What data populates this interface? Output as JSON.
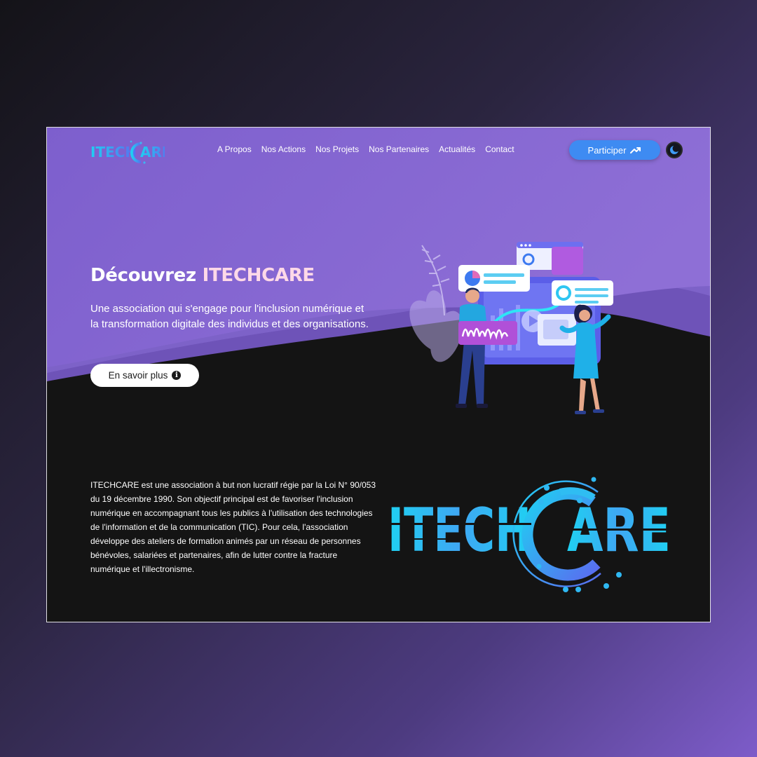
{
  "brand": {
    "logo_text_left": "ITECH",
    "logo_text_right": "ARE",
    "primary_color": "#3e8bf2",
    "accent_gradient": [
      "#1fd0f2",
      "#5a6cf0"
    ]
  },
  "nav": {
    "items": [
      {
        "label": "A Propos"
      },
      {
        "label": "Nos Actions"
      },
      {
        "label": "Nos Projets"
      },
      {
        "label": "Nos Partenaires"
      },
      {
        "label": "Actualités"
      },
      {
        "label": "Contact"
      }
    ]
  },
  "header": {
    "participate_label": "Participer",
    "participate_icon": "trending-up-icon",
    "theme_toggle_icon": "moon-icon"
  },
  "hero": {
    "title_prefix": "Découvrez ",
    "title_brand": "ITECHCARE",
    "subtitle": "Une association qui s'engage pour l'inclusion numérique et la transformation digitale des individus et des organisations.",
    "cta_label": "En savoir plus",
    "cta_icon": "info-icon",
    "illustration": "people-with-dashboard-illustration"
  },
  "about": {
    "text": "ITECHCARE est une association à but non lucratif régie par la Loi N° 90/053 du 19 décembre 1990. Son objectif principal est de favoriser l'inclusion numérique en accompagnant tous les publics à l'utilisation des technologies de l'information et de la communication (TIC). Pour cela, l'association développe des ateliers de formation animés par un réseau de personnes bénévoles, salariées et partenaires, afin de lutter contre la fracture numérique et l'illectronisme."
  }
}
